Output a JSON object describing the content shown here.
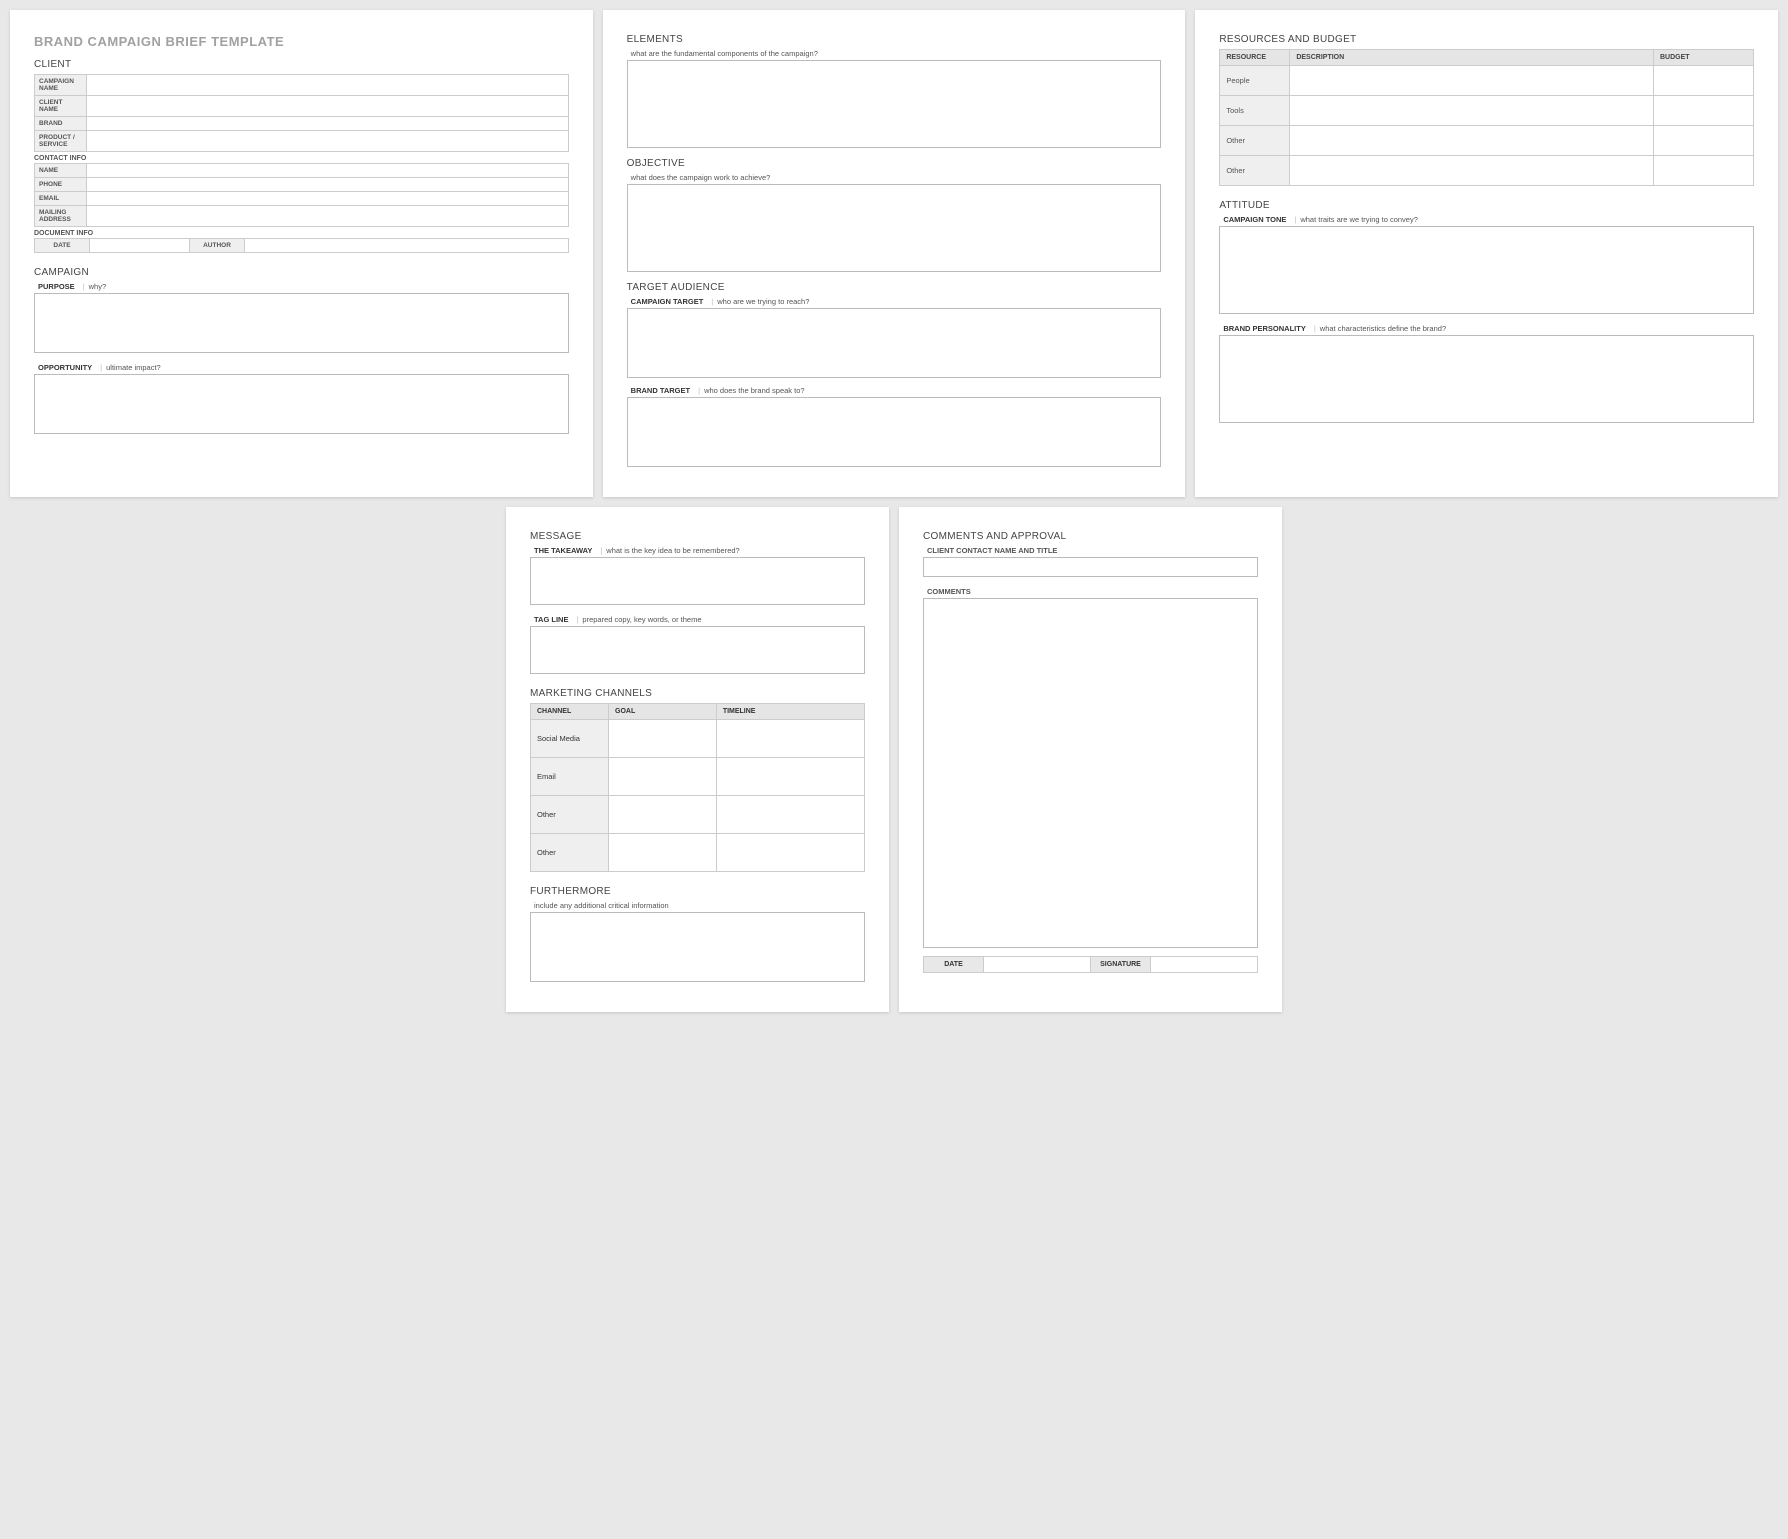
{
  "title": "BRAND CAMPAIGN BRIEF TEMPLATE",
  "p1": {
    "client_header": "CLIENT",
    "client_rows": {
      "campaign_name": "CAMPAIGN NAME",
      "client_name": "CLIENT NAME",
      "brand": "BRAND",
      "product_service": "PRODUCT / SERVICE"
    },
    "contact_header": "CONTACT INFO",
    "contact_rows": {
      "name": "NAME",
      "phone": "PHONE",
      "email": "EMAIL",
      "mailing": "MAILING ADDRESS"
    },
    "docinfo_header": "DOCUMENT INFO",
    "docinfo": {
      "date": "DATE",
      "author": "AUTHOR"
    },
    "campaign_header": "CAMPAIGN",
    "purpose_label": "PURPOSE",
    "purpose_hint": "why?",
    "opportunity_label": "OPPORTUNITY",
    "opportunity_hint": "ultimate impact?"
  },
  "p2": {
    "elements_header": "ELEMENTS",
    "elements_hint": "what are the fundamental components of the campaign?",
    "objective_header": "OBJECTIVE",
    "objective_hint": "what does the campaign work to achieve?",
    "target_header": "TARGET AUDIENCE",
    "campaign_target_label": "CAMPAIGN TARGET",
    "campaign_target_hint": "who are we trying to reach?",
    "brand_target_label": "BRAND TARGET",
    "brand_target_hint": "who does the brand speak to?"
  },
  "p3": {
    "resources_header": "RESOURCES AND BUDGET",
    "res_cols": {
      "resource": "RESOURCE",
      "description": "DESCRIPTION",
      "budget": "BUDGET"
    },
    "res_rows": [
      "People",
      "Tools",
      "Other",
      "Other"
    ],
    "attitude_header": "ATTITUDE",
    "tone_label": "CAMPAIGN TONE",
    "tone_hint": "what traits are we trying to convey?",
    "personality_label": "BRAND PERSONALITY",
    "personality_hint": "what characteristics define the brand?"
  },
  "p4": {
    "message_header": "MESSAGE",
    "takeaway_label": "THE TAKEAWAY",
    "takeaway_hint": "what is the key idea to be remembered?",
    "tagline_label": "TAG LINE",
    "tagline_hint": "prepared copy, key words, or theme",
    "marketing_header": "MARKETING CHANNELS",
    "mc_cols": {
      "channel": "CHANNEL",
      "goal": "GOAL",
      "timeline": "TIMELINE"
    },
    "mc_rows": [
      "Social Media",
      "Email",
      "Other",
      "Other"
    ],
    "furthermore_header": "FURTHERMORE",
    "furthermore_hint": "include any additional critical information"
  },
  "p5": {
    "comments_header": "COMMENTS AND APPROVAL",
    "contact_label": "CLIENT CONTACT NAME AND TITLE",
    "comments_label": "COMMENTS",
    "sig": {
      "date": "DATE",
      "signature": "SIGNATURE"
    }
  }
}
